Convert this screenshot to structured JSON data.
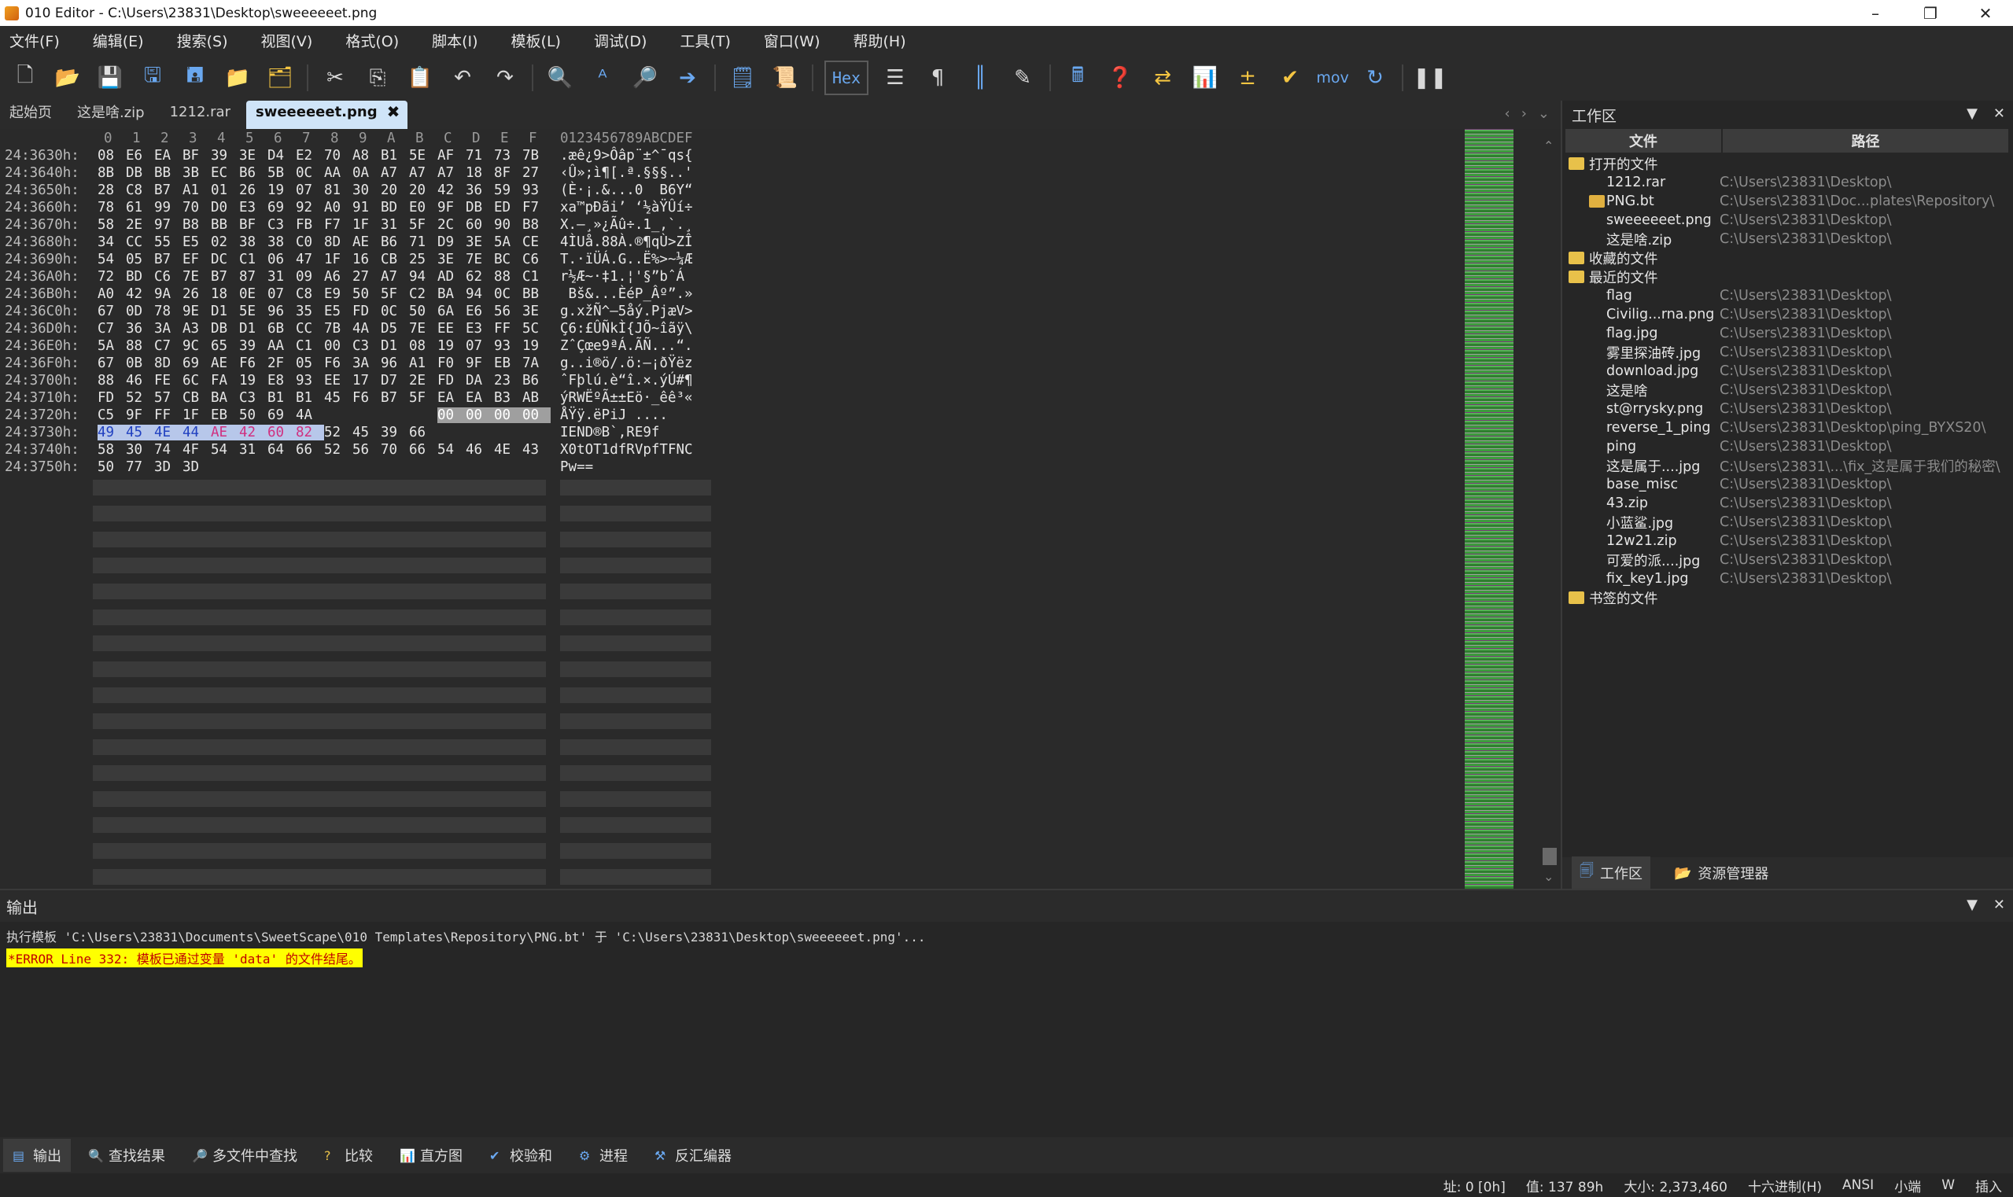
{
  "window": {
    "title": "010 Editor - C:\\Users\\23831\\Desktop\\sweeeeeet.png",
    "minimize": "–",
    "restore": "❐",
    "close": "✕"
  },
  "menu": [
    "文件(F)",
    "编辑(E)",
    "搜索(S)",
    "视图(V)",
    "格式(O)",
    "脚本(I)",
    "模板(L)",
    "调试(D)",
    "工具(T)",
    "窗口(W)",
    "帮助(H)"
  ],
  "toolbar": {
    "hex_label": "Hex",
    "mov_label": "mov"
  },
  "tabs": [
    {
      "label": "起始页",
      "active": false
    },
    {
      "label": "这是啥.zip",
      "active": false
    },
    {
      "label": "1212.rar",
      "active": false
    },
    {
      "label": "sweeeeeet.png",
      "active": true
    }
  ],
  "hex": {
    "col_header_hex": [
      "0",
      "1",
      "2",
      "3",
      "4",
      "5",
      "6",
      "7",
      "8",
      "9",
      "A",
      "B",
      "C",
      "D",
      "E",
      "F"
    ],
    "col_header_ascii": "0123456789ABCDEF",
    "rows": [
      {
        "addr": "24:3630h:",
        "bytes": [
          "08",
          "E6",
          "EA",
          "BF",
          "39",
          "3E",
          "D4",
          "E2",
          "70",
          "A8",
          "B1",
          "5E",
          "AF",
          "71",
          "73",
          "7B"
        ],
        "ascii": ".æê¿9>Ôâp¨±^¯qs{"
      },
      {
        "addr": "24:3640h:",
        "bytes": [
          "8B",
          "DB",
          "BB",
          "3B",
          "EC",
          "B6",
          "5B",
          "0C",
          "AA",
          "0A",
          "A7",
          "A7",
          "A7",
          "18",
          "8F",
          "27"
        ],
        "ascii": "‹Û»;ì¶[.ª.§§§..'"
      },
      {
        "addr": "24:3650h:",
        "bytes": [
          "28",
          "C8",
          "B7",
          "A1",
          "01",
          "26",
          "19",
          "07",
          "81",
          "30",
          "20",
          "20",
          "42",
          "36",
          "59",
          "93"
        ],
        "ascii": "(È·¡.&...0  B6Y“"
      },
      {
        "addr": "24:3660h:",
        "bytes": [
          "78",
          "61",
          "99",
          "70",
          "D0",
          "E3",
          "69",
          "92",
          "A0",
          "91",
          "BD",
          "E0",
          "9F",
          "DB",
          "ED",
          "F7"
        ],
        "ascii": "xa™pÐãi’ ‘½àŸÛí÷"
      },
      {
        "addr": "24:3670h:",
        "bytes": [
          "58",
          "2E",
          "97",
          "B8",
          "BB",
          "BF",
          "C3",
          "FB",
          "F7",
          "1F",
          "31",
          "5F",
          "2C",
          "60",
          "90",
          "B8"
        ],
        "ascii": "X.—¸»¿Ãû÷.1_,`.¸"
      },
      {
        "addr": "24:3680h:",
        "bytes": [
          "34",
          "CC",
          "55",
          "E5",
          "02",
          "38",
          "38",
          "C0",
          "8D",
          "AE",
          "B6",
          "71",
          "D9",
          "3E",
          "5A",
          "CE"
        ],
        "ascii": "4ÌUå.88À.®¶qÙ>ZÎ"
      },
      {
        "addr": "24:3690h:",
        "bytes": [
          "54",
          "05",
          "B7",
          "EF",
          "DC",
          "C1",
          "06",
          "47",
          "1F",
          "16",
          "CB",
          "25",
          "3E",
          "7E",
          "BC",
          "C6"
        ],
        "ascii": "T.·ïÜÁ.G..Ë%>~¼Æ"
      },
      {
        "addr": "24:36A0h:",
        "bytes": [
          "72",
          "BD",
          "C6",
          "7E",
          "B7",
          "87",
          "31",
          "09",
          "A6",
          "27",
          "A7",
          "94",
          "AD",
          "62",
          "88",
          "C1"
        ],
        "ascii": "r½Æ~·‡1.¦'§”­bˆÁ"
      },
      {
        "addr": "24:36B0h:",
        "bytes": [
          "A0",
          "42",
          "9A",
          "26",
          "18",
          "0E",
          "07",
          "C8",
          "E9",
          "50",
          "5F",
          "C2",
          "BA",
          "94",
          "0C",
          "BB"
        ],
        "ascii": " Bš&...ÈéP_Âº”.»"
      },
      {
        "addr": "24:36C0h:",
        "bytes": [
          "67",
          "0D",
          "78",
          "9E",
          "D1",
          "5E",
          "96",
          "35",
          "E5",
          "FD",
          "0C",
          "50",
          "6A",
          "E6",
          "56",
          "3E"
        ],
        "ascii": "g.xžÑ^–5åý.PjæV>"
      },
      {
        "addr": "24:36D0h:",
        "bytes": [
          "C7",
          "36",
          "3A",
          "A3",
          "DB",
          "D1",
          "6B",
          "CC",
          "7B",
          "4A",
          "D5",
          "7E",
          "EE",
          "E3",
          "FF",
          "5C"
        ],
        "ascii": "Ç6:£ÛÑkÌ{JÕ~îãÿ\\"
      },
      {
        "addr": "24:36E0h:",
        "bytes": [
          "5A",
          "88",
          "C7",
          "9C",
          "65",
          "39",
          "AA",
          "C1",
          "00",
          "C3",
          "D1",
          "08",
          "19",
          "07",
          "93",
          "19"
        ],
        "ascii": "ZˆÇœe9ªÁ.ÃÑ...“."
      },
      {
        "addr": "24:36F0h:",
        "bytes": [
          "67",
          "0B",
          "8D",
          "69",
          "AE",
          "F6",
          "2F",
          "05",
          "F6",
          "3A",
          "96",
          "A1",
          "F0",
          "9F",
          "EB",
          "7A"
        ],
        "ascii": "g..i®ö/.ö:–¡ðŸëz"
      },
      {
        "addr": "24:3700h:",
        "bytes": [
          "88",
          "46",
          "FE",
          "6C",
          "FA",
          "19",
          "E8",
          "93",
          "EE",
          "17",
          "D7",
          "2E",
          "FD",
          "DA",
          "23",
          "B6"
        ],
        "ascii": "ˆFþlú.è“î.×.ýÚ#¶"
      },
      {
        "addr": "24:3710h:",
        "bytes": [
          "FD",
          "52",
          "57",
          "CB",
          "BA",
          "C3",
          "B1",
          "B1",
          "45",
          "F6",
          "B7",
          "5F",
          "EA",
          "EA",
          "B3",
          "AB"
        ],
        "ascii": "ýRWËºÃ±±Eö·_êê³«"
      },
      {
        "addr": "24:3720h:",
        "bytes": [
          "C5",
          "9F",
          "FF",
          "1F",
          "EB",
          "50",
          "69",
          "4A",
          "",
          "",
          "",
          "",
          "00",
          "00",
          "00",
          "00"
        ],
        "ascii": "ÅŸÿ.ëPiJ ...."
      },
      {
        "addr": "24:3730h:",
        "bytes": [
          "49",
          "45",
          "4E",
          "44",
          "AE",
          "42",
          "60",
          "82",
          "52",
          "45",
          "39",
          "66",
          "",
          "",
          "",
          ""
        ],
        "ascii": "IEND®B`‚RE9f"
      },
      {
        "addr": "24:3740h:",
        "bytes": [
          "58",
          "30",
          "74",
          "4F",
          "54",
          "31",
          "64",
          "66",
          "52",
          "56",
          "70",
          "66",
          "54",
          "46",
          "4E",
          "43"
        ],
        "ascii": "X0tOT1dfRVpfTFNC"
      },
      {
        "addr": "24:3750h:",
        "bytes": [
          "50",
          "77",
          "3D",
          "3D"
        ],
        "ascii": "Pw=="
      }
    ]
  },
  "workspace": {
    "title": "工作区",
    "col_file": "文件",
    "col_path": "路径",
    "groups": [
      {
        "label": "打开的文件",
        "items": [
          {
            "name": "1212.rar",
            "path": "C:\\Users\\23831\\Desktop\\"
          },
          {
            "name": "PNG.bt",
            "path": "C:\\Users\\23831\\Doc...plates\\Repository\\"
          },
          {
            "name": "sweeeeeet.png",
            "path": "C:\\Users\\23831\\Desktop\\"
          },
          {
            "name": "这是啥.zip",
            "path": "C:\\Users\\23831\\Desktop\\"
          }
        ]
      },
      {
        "label": "收藏的文件",
        "items": []
      },
      {
        "label": "最近的文件",
        "items": [
          {
            "name": "flag",
            "path": "C:\\Users\\23831\\Desktop\\"
          },
          {
            "name": "Civilig...rna.png",
            "path": "C:\\Users\\23831\\Desktop\\"
          },
          {
            "name": "flag.jpg",
            "path": "C:\\Users\\23831\\Desktop\\"
          },
          {
            "name": "雾里探油砖.jpg",
            "path": "C:\\Users\\23831\\Desktop\\"
          },
          {
            "name": "download.jpg",
            "path": "C:\\Users\\23831\\Desktop\\"
          },
          {
            "name": "这是啥",
            "path": "C:\\Users\\23831\\Desktop\\"
          },
          {
            "name": "st@rrysky.png",
            "path": "C:\\Users\\23831\\Desktop\\"
          },
          {
            "name": "reverse_1_ping",
            "path": "C:\\Users\\23831\\Desktop\\ping_BYXS20\\"
          },
          {
            "name": "ping",
            "path": "C:\\Users\\23831\\Desktop\\"
          },
          {
            "name": "这是属于....jpg",
            "path": "C:\\Users\\23831\\...\\fix_这是属于我们的秘密\\"
          },
          {
            "name": "base_misc",
            "path": "C:\\Users\\23831\\Desktop\\"
          },
          {
            "name": "43.zip",
            "path": "C:\\Users\\23831\\Desktop\\"
          },
          {
            "name": "小蓝鲨.jpg",
            "path": "C:\\Users\\23831\\Desktop\\"
          },
          {
            "name": "12w21.zip",
            "path": "C:\\Users\\23831\\Desktop\\"
          },
          {
            "name": "可爱的派....jpg",
            "path": "C:\\Users\\23831\\Desktop\\"
          },
          {
            "name": "fix_key1.jpg",
            "path": "C:\\Users\\23831\\Desktop\\"
          }
        ]
      },
      {
        "label": "书签的文件",
        "items": []
      }
    ],
    "bottom_tabs": [
      "工作区",
      "资源管理器"
    ]
  },
  "output": {
    "title": "输出",
    "line1": "执行模板 'C:\\Users\\23831\\Documents\\SweetScape\\010 Templates\\Repository\\PNG.bt' 于 'C:\\Users\\23831\\Desktop\\sweeeeeet.png'...",
    "line2": "*ERROR Line 332: 模板已通过变量 'data' 的文件结尾。"
  },
  "bottom_tabs": [
    "输出",
    "查找结果",
    "多文件中查找",
    "比较",
    "直方图",
    "校验和",
    "进程",
    "反汇编器"
  ],
  "status": {
    "addr": "址: 0 [0h]",
    "value": "值: 137 89h",
    "size": "大小: 2,373,460",
    "mode": "十六进制(H)",
    "encoding": "ANSI",
    "endian": "小端",
    "w": "W",
    "insert": "插入"
  }
}
